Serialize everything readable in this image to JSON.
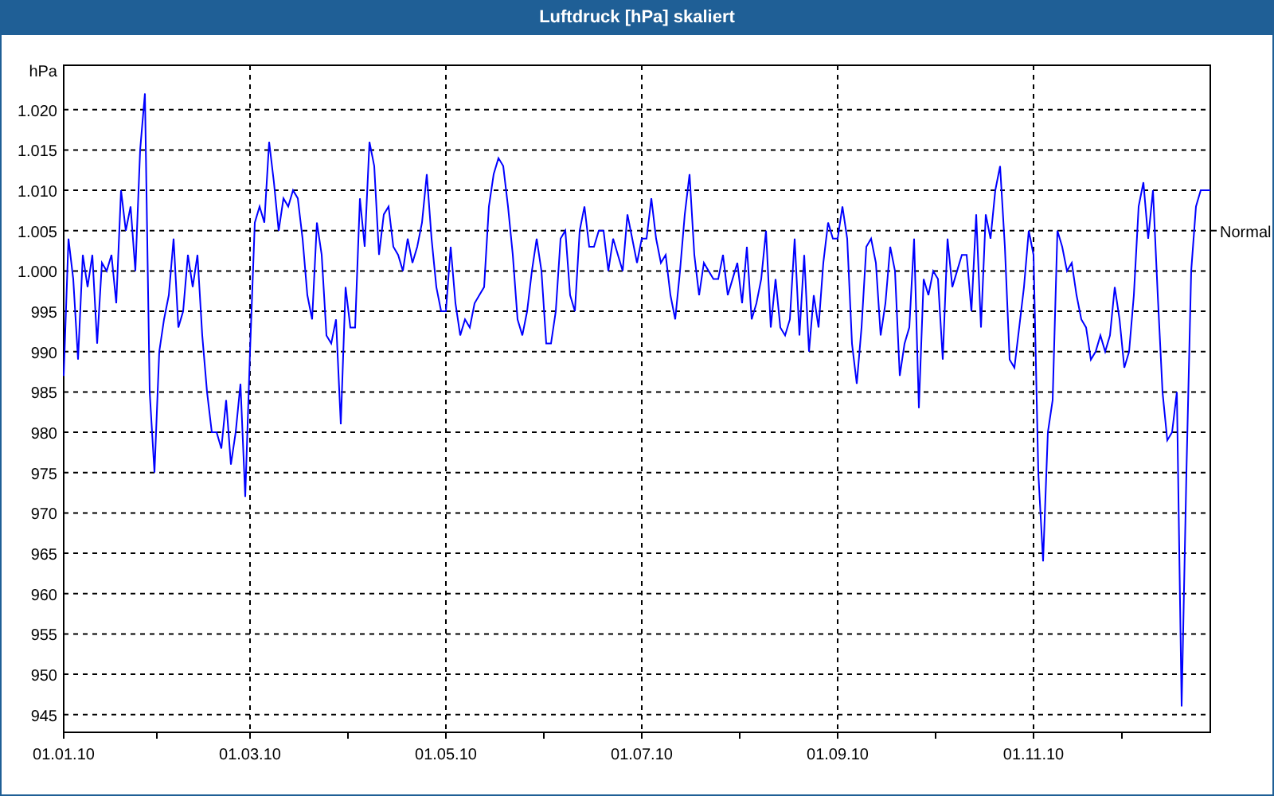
{
  "window": {
    "title": "Luftdruck [hPa] skaliert"
  },
  "chart": {
    "chart_data": {
      "type": "line",
      "ylabel": "hPa",
      "ylim": [
        942.8,
        1025.5
      ],
      "yticks": [
        {
          "value": 945,
          "label": "945"
        },
        {
          "value": 950,
          "label": "950"
        },
        {
          "value": 955,
          "label": "955"
        },
        {
          "value": 960,
          "label": "960"
        },
        {
          "value": 965,
          "label": "965"
        },
        {
          "value": 970,
          "label": "970"
        },
        {
          "value": 975,
          "label": "975"
        },
        {
          "value": 980,
          "label": "980"
        },
        {
          "value": 985,
          "label": "985"
        },
        {
          "value": 990,
          "label": "990"
        },
        {
          "value": 995,
          "label": "995"
        },
        {
          "value": 1000,
          "label": "1.000"
        },
        {
          "value": 1005,
          "label": "1.005"
        },
        {
          "value": 1010,
          "label": "1.010"
        },
        {
          "value": 1015,
          "label": "1.015"
        },
        {
          "value": 1020,
          "label": "1.020"
        }
      ],
      "grid": true,
      "annotations": [
        "Normal"
      ],
      "categories": [
        "01.01.10",
        null,
        null,
        null,
        null,
        null,
        null,
        null,
        null,
        null,
        null,
        null,
        null,
        null,
        null,
        null,
        null,
        null,
        null,
        null,
        null,
        null,
        null,
        null,
        null,
        null,
        null,
        null,
        null,
        null,
        null,
        null,
        null,
        null,
        null,
        null,
        null,
        null,
        null,
        "01.03.10",
        null,
        null,
        null,
        null,
        null,
        null,
        null,
        null,
        null,
        null,
        null,
        null,
        null,
        null,
        null,
        null,
        null,
        null,
        null,
        null,
        null,
        null,
        null,
        null,
        null,
        null,
        null,
        null,
        null,
        null,
        null,
        null,
        null,
        null,
        null,
        null,
        null,
        null,
        null,
        null,
        "01.05.10",
        null,
        null,
        null,
        null,
        null,
        null,
        null,
        null,
        null,
        null,
        null,
        null,
        null,
        null,
        null,
        null,
        null,
        null,
        null,
        null,
        null,
        null,
        null,
        null,
        null,
        null,
        null,
        null,
        null,
        null,
        null,
        null,
        null,
        null,
        null,
        null,
        null,
        null,
        null,
        null,
        "01.07.10",
        null,
        null,
        null,
        null,
        null,
        null,
        null,
        null,
        null,
        null,
        null,
        null,
        null,
        null,
        null,
        null,
        null,
        null,
        null,
        null,
        null,
        null,
        null,
        null,
        null,
        null,
        null,
        null,
        null,
        null,
        null,
        null,
        null,
        null,
        null,
        null,
        null,
        null,
        null,
        null,
        "01.09.10",
        null,
        null,
        null,
        null,
        null,
        null,
        null,
        null,
        null,
        null,
        null,
        null,
        null,
        null,
        null,
        null,
        null,
        null,
        null,
        null,
        null,
        null,
        null,
        null,
        null,
        null,
        null,
        null,
        null,
        null,
        null,
        null,
        null,
        null,
        null,
        null,
        null,
        null,
        null,
        null,
        "01.11.10",
        null,
        null,
        null,
        null,
        null,
        null,
        null,
        null,
        null,
        null,
        null,
        null,
        null,
        null,
        null,
        null,
        null,
        null,
        null,
        null,
        null,
        null,
        null,
        null,
        null,
        null,
        null,
        null,
        null,
        null,
        null,
        null,
        null,
        null,
        null,
        null,
        null
      ],
      "series": [
        {
          "color": "#0000ff",
          "values": [
            987,
            1004,
            999,
            989,
            1002,
            998,
            1002,
            991,
            1001,
            1000,
            1002,
            996,
            1010,
            1005,
            1008,
            1000,
            1015,
            1022,
            985,
            975,
            990,
            994,
            997,
            1004,
            993,
            995,
            1002,
            998,
            1002,
            992,
            985,
            980,
            980,
            978,
            984,
            976,
            980,
            986,
            972,
            990,
            1006,
            1008,
            1006,
            1016,
            1011,
            1005,
            1009,
            1008,
            1010,
            1009,
            1004,
            997,
            994,
            1006,
            1002,
            992,
            991,
            994,
            981,
            998,
            993,
            993,
            1009,
            1003,
            1016,
            1013,
            1002,
            1007,
            1008,
            1003,
            1002,
            1000,
            1004,
            1001,
            1003,
            1006,
            1012,
            1004,
            998,
            995,
            995,
            1003,
            996,
            992,
            994,
            993,
            996,
            997,
            998,
            1008,
            1012,
            1014,
            1013,
            1008,
            1002,
            994,
            992,
            995,
            1000,
            1004,
            1000,
            991,
            991,
            995,
            1004,
            1005,
            997,
            995,
            1005,
            1008,
            1003,
            1003,
            1005,
            1005,
            1000,
            1004,
            1002,
            1000,
            1007,
            1004,
            1001,
            1004,
            1004,
            1009,
            1004,
            1001,
            1002,
            997,
            994,
            1000,
            1007,
            1012,
            1002,
            997,
            1001,
            1000,
            999,
            999,
            1002,
            997,
            999,
            1001,
            996,
            1003,
            994,
            996,
            999,
            1005,
            993,
            999,
            993,
            992,
            994,
            1004,
            992,
            1002,
            990,
            997,
            993,
            1001,
            1006,
            1004,
            1004,
            1008,
            1004,
            991,
            986,
            993,
            1003,
            1004,
            1001,
            992,
            996,
            1003,
            1000,
            987,
            991,
            993,
            1004,
            983,
            999,
            997,
            1000,
            999,
            989,
            1004,
            998,
            1000,
            1002,
            1002,
            995,
            1007,
            993,
            1007,
            1004,
            1010,
            1013,
            1003,
            989,
            988,
            993,
            998,
            1005,
            1002,
            975,
            964,
            980,
            984,
            1005,
            1003,
            1000,
            1001,
            997,
            994,
            993,
            989,
            990,
            992,
            990,
            992,
            998,
            994,
            988,
            990,
            997,
            1008,
            1011,
            1004,
            1010,
            997,
            985,
            979,
            980,
            985,
            946,
            975,
            1000,
            1008,
            1010,
            1010,
            1010
          ]
        }
      ]
    }
  }
}
